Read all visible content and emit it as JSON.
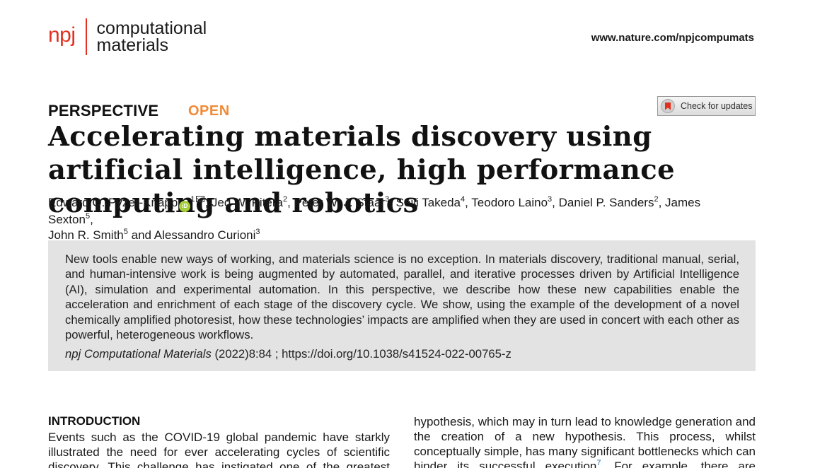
{
  "header": {
    "logo_mark": "npj",
    "logo_line1": "computational",
    "logo_line2": "materials",
    "url": "www.nature.com/npjcompumats"
  },
  "article": {
    "type": "PERSPECTIVE",
    "access": "OPEN",
    "check_updates": "Check for updates",
    "title": "Accelerating materials discovery using artificial intelligence, high performance computing and robotics",
    "authors": [
      {
        "name": "Edward O. Pyzer-Knapp",
        "aff": "1"
      },
      {
        "name": "Jed W. Pitera",
        "aff": "2"
      },
      {
        "name": "Peter W. J. Staar",
        "aff": "3"
      },
      {
        "name": "Seiji Takeda",
        "aff": "4"
      },
      {
        "name": "Teodoro Laino",
        "aff": "3"
      },
      {
        "name": "Daniel P. Sanders",
        "aff": "2"
      },
      {
        "name": "James Sexton",
        "aff": "5"
      },
      {
        "name": "John R. Smith",
        "aff": "5"
      },
      {
        "name": "Alessandro Curioni",
        "aff": "3"
      }
    ],
    "author_sep": ", ",
    "author_and": " and ",
    "abstract": "New tools enable new ways of working, and materials science is no exception. In materials discovery, traditional manual, serial, and human-intensive work is being augmented by automated, parallel, and iterative processes driven by Artificial Intelligence (AI), simulation and experimental automation. In this perspective, we describe how these new capabilities enable the acceleration and enrichment of each stage of the discovery cycle. We show, using the example of the development of a novel chemically amplified photoresist, how these technologies’ impacts are amplified when they are used in concert with each other as powerful, heterogeneous workflows.",
    "journal": "npj Computational Materials",
    "citation_rest": " (2022)8:84 ; https://doi.org/10.1038/s41524-022-00765-z"
  },
  "body": {
    "intro_heading": "INTRODUCTION",
    "left_col": "Events such as the COVID-19 global pandemic have starkly illustrated the need for ever accelerating cycles of scientific discovery. This challenge has instigated one of the greatest races",
    "right_col_a": "hypothesis, which may in turn lead to knowledge generation and the creation of a new hypothesis. This process, whilst conceptually simple, has many significant bottlenecks which can hinder its successful execution",
    "right_ref": "7",
    "right_col_b": ". For example, there are challenges in"
  },
  "colors": {
    "brand": "#e2301f",
    "open": "#f08a36",
    "abstract_bg": "#e3e3e3",
    "link": "#1f6fb3"
  }
}
